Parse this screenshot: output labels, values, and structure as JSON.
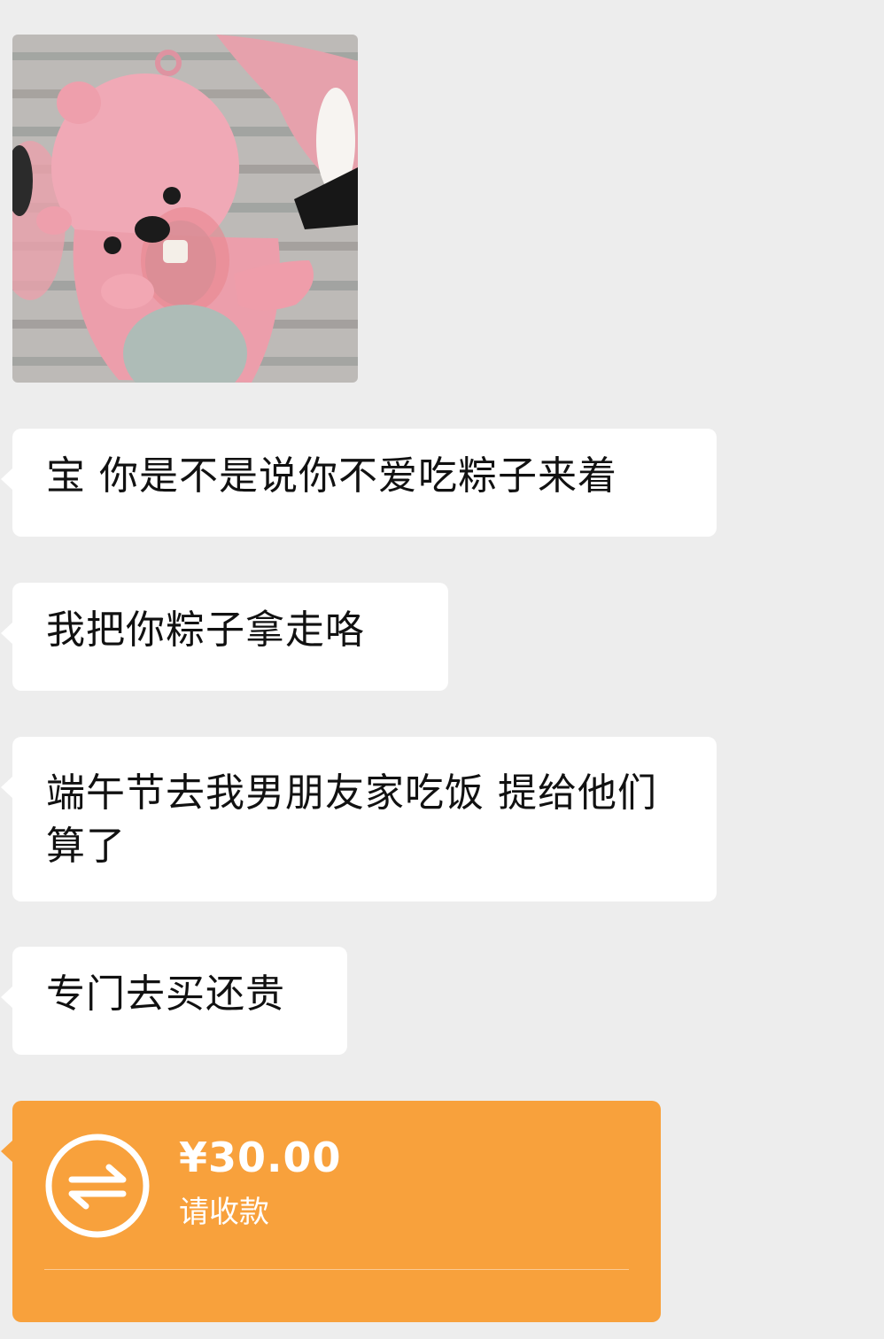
{
  "messages": [
    {
      "text": "宝 你是不是说你不爱吃粽子来着"
    },
    {
      "text": "我把你粽子拿走咯"
    },
    {
      "text": "端午节去我男朋友家吃饭 提给他们算了"
    },
    {
      "text": "专门去买还贵"
    }
  ],
  "sticker": {
    "icon": "pink-beaver-plush-sticker"
  },
  "transfer": {
    "amount": "¥30.00",
    "status": "请收款",
    "icon": "transfer-arrows-icon",
    "color": "#f8a13c"
  },
  "colors": {
    "background": "#ededed",
    "bubble": "#ffffff",
    "text": "#111111"
  }
}
